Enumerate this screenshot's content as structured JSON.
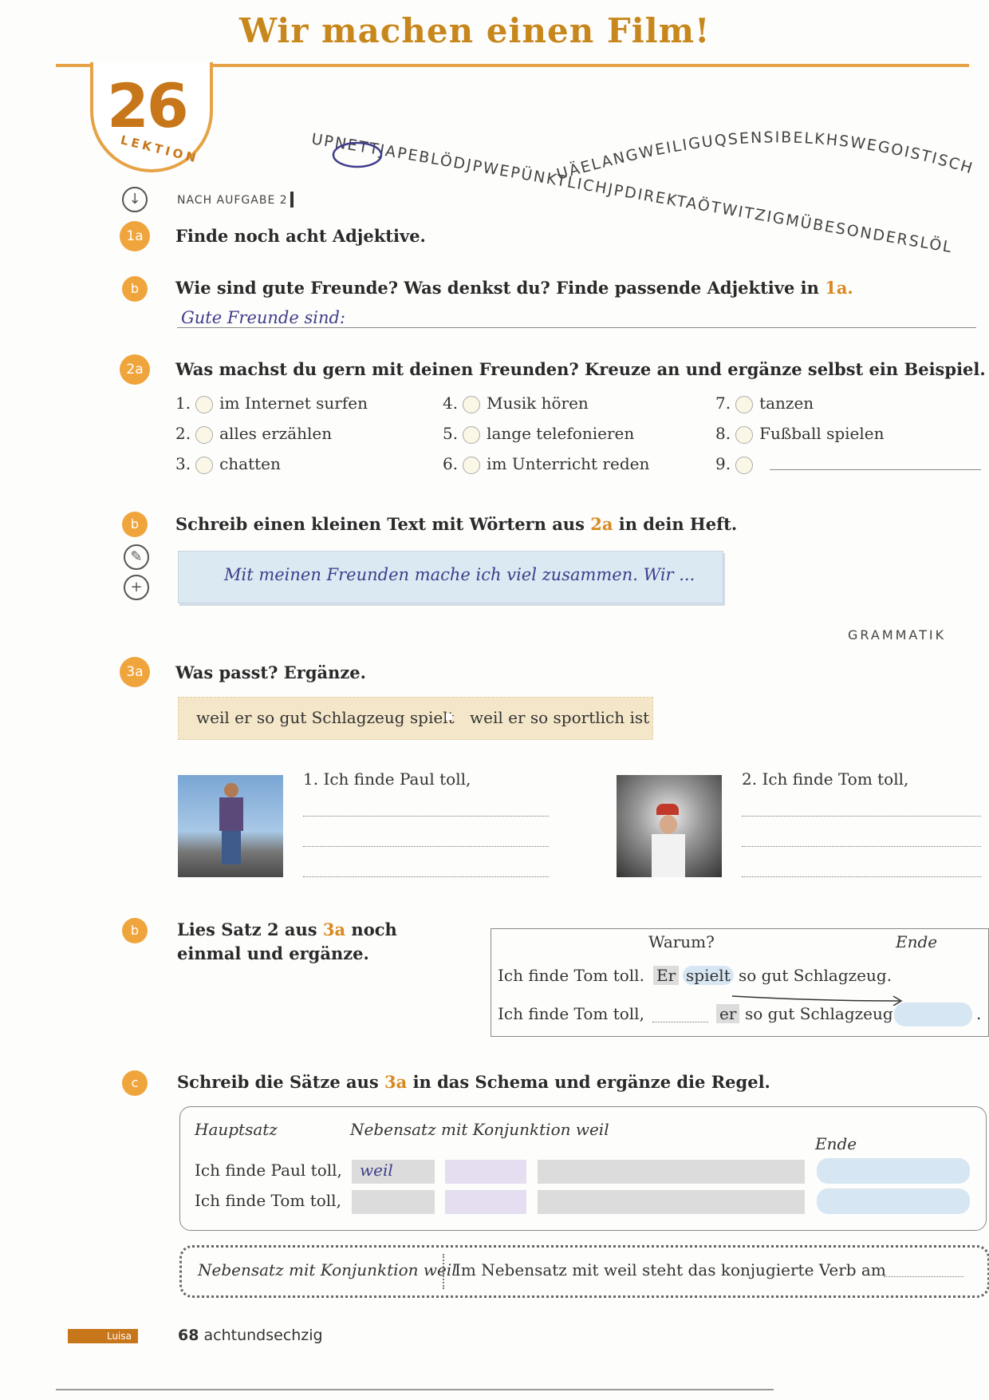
{
  "header": {
    "title": "Wir machen einen Film!",
    "lesson_number": "26",
    "lesson_word": "LEKTION"
  },
  "puzzle": {
    "line1": "UPNETTJAPEBLÖDJPWEPÜNKTLICHJPDIREKTAÖTWITZIGMÜBESONDERSLÖL",
    "line2": "UÄELANGWEILIGUQSENSIBELKHSWEGOISTISCH"
  },
  "section_note": "NACH AUFGABE 2",
  "ex1a": {
    "badge": "1a",
    "instruction": "Finde noch acht Adjektive."
  },
  "ex1b": {
    "badge": "b",
    "instruction": "Wie sind gute Freunde? Was denkst du? Finde passende Adjektive in",
    "ref": "1a.",
    "handwriting": "Gute Freunde sind:"
  },
  "ex2a": {
    "badge": "2a",
    "instruction": "Was machst du gern mit deinen Freunden? Kreuze an und ergänze selbst ein Beispiel.",
    "items": [
      {
        "num": "1.",
        "text": "im Internet surfen"
      },
      {
        "num": "2.",
        "text": "alles erzählen"
      },
      {
        "num": "3.",
        "text": "chatten"
      },
      {
        "num": "4.",
        "text": "Musik hören"
      },
      {
        "num": "5.",
        "text": "lange telefonieren"
      },
      {
        "num": "6.",
        "text": "im Unterricht reden"
      },
      {
        "num": "7.",
        "text": "tanzen"
      },
      {
        "num": "8.",
        "text": "Fußball spielen"
      },
      {
        "num": "9.",
        "text": ""
      }
    ]
  },
  "ex2b": {
    "badge": "b",
    "instruction_pre": "Schreib einen kleinen Text mit Wörtern aus",
    "ref": "2a",
    "instruction_post": "in dein Heft.",
    "example": "Mit meinen Freunden mache ich viel zusammen. Wir ..."
  },
  "grammar_label": "GRAMMATIK",
  "ex3a": {
    "badge": "3a",
    "instruction": "Was passt? Ergänze.",
    "options": [
      "weil er so gut Schlagzeug spielt",
      "weil er so sportlich ist"
    ],
    "sentence1": "1. Ich finde Paul toll,",
    "sentence2": "2. Ich finde Tom toll,"
  },
  "ex3b": {
    "badge": "b",
    "instruction_pre": "Lies Satz 2 aus",
    "ref": "3a",
    "instruction_post": "noch einmal und ergänze.",
    "table": {
      "head_warum": "Warum?",
      "head_ende": "Ende",
      "row1_start": "Ich finde Tom toll.",
      "row1_er": "Er",
      "row1_verb": "spielt",
      "row1_rest": "so gut Schlagzeug.",
      "row2_start": "Ich finde Tom toll,",
      "row2_er": "er",
      "row2_rest": "so gut Schlagzeug",
      "row2_end": "."
    }
  },
  "ex3c": {
    "badge": "c",
    "instruction_pre": "Schreib die Sätze aus",
    "ref": "3a",
    "instruction_post": "in das Schema und ergänze die Regel.",
    "schema": {
      "head_main": "Hauptsatz",
      "head_sub": "Nebensatz mit Konjunktion weil",
      "head_end": "Ende",
      "row1": "Ich finde Paul toll,",
      "row1_weil": "weil",
      "row2": "Ich finde Tom toll,"
    }
  },
  "rule": {
    "left": "Nebensatz mit Konjunktion weil",
    "right": "Im Nebensatz mit weil steht das konjugierte Verb am"
  },
  "footer": {
    "tab": "Luisa",
    "page_number": "68",
    "page_word": "achtundsechzig"
  },
  "colors": {
    "accent": "#f0a53c",
    "title": "#c8871c",
    "handwriting": "#3e3d8a"
  }
}
